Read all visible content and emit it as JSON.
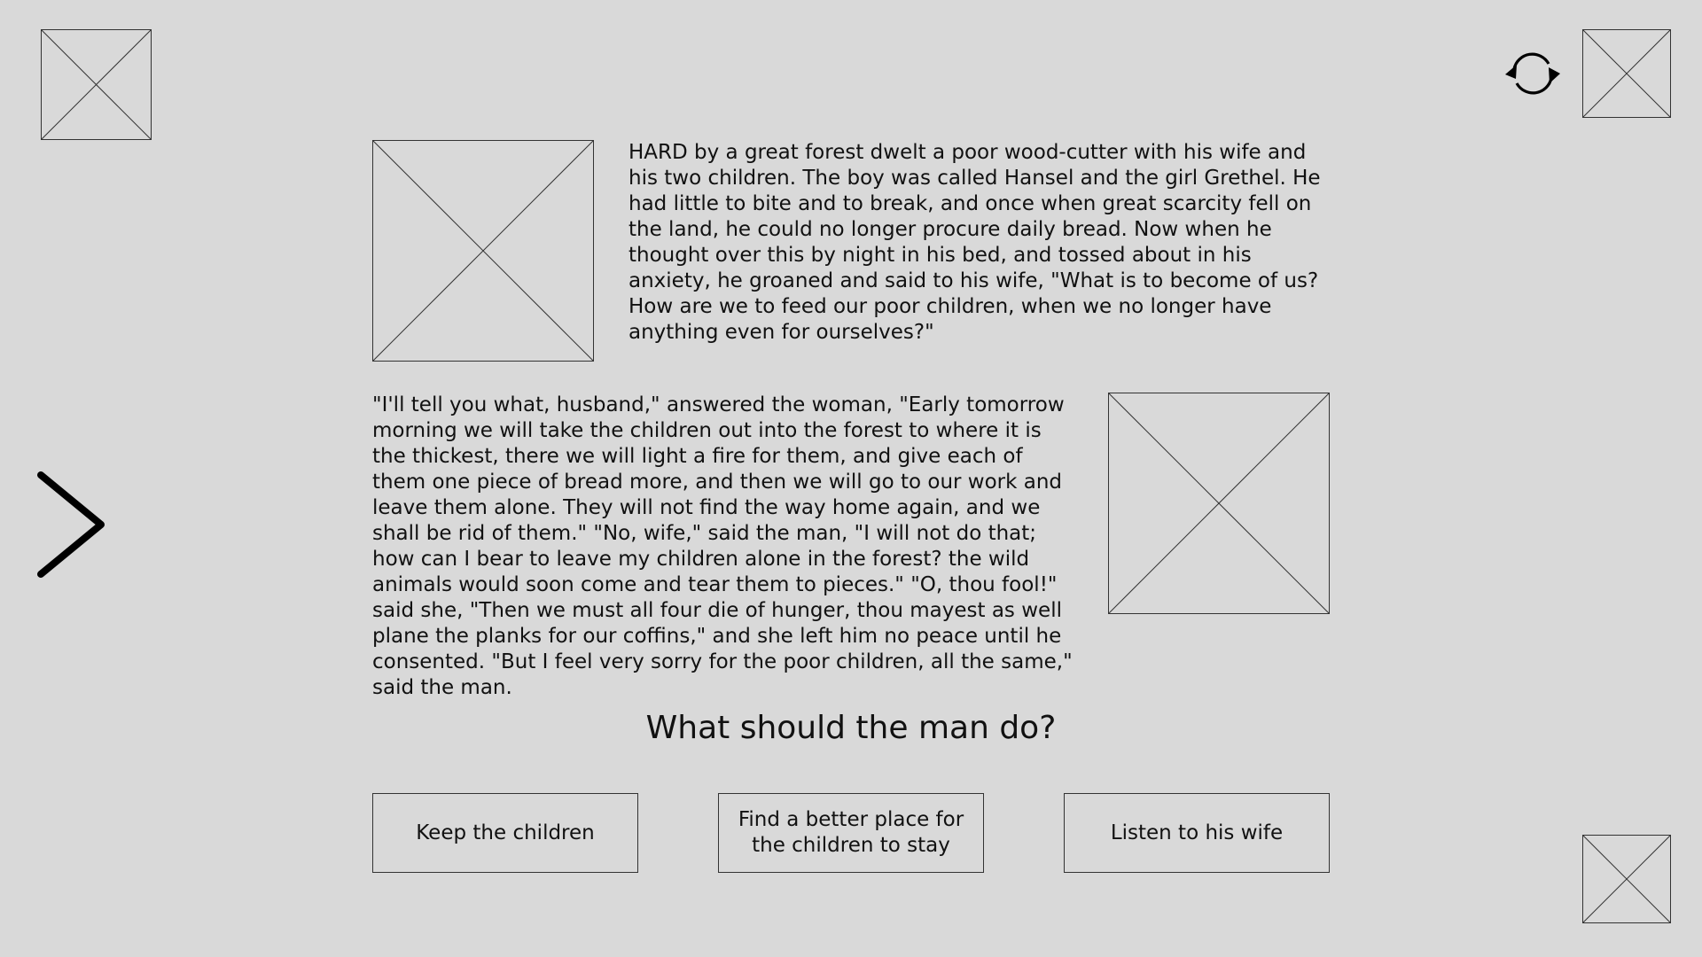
{
  "story": {
    "paragraph_1": "HARD by a great forest dwelt a poor wood-cutter with his wife and his two children. The boy was called Hansel and the girl Grethel. He had little to bite and to break, and once when great scarcity fell on the land, he could no longer procure daily bread. Now when he thought over this by night in his bed, and tossed about in his anxiety, he groaned and said to his wife, \"What is to become of us? How are we to feed our poor children, when we no longer have anything even for ourselves?\"",
    "paragraph_2": "\"I'll tell you what, husband,\" answered the woman, \"Early tomorrow morning we will take the children out into the forest to where it is the thickest, there we will light a fire for them, and give each of them one piece of bread more, and then we will go to our work and leave them alone. They will not find the way home again, and we shall be rid of them.\" \"No, wife,\" said the man, \"I will not do that; how can I bear to leave my children alone in the forest? the wild animals would soon come and tear them to pieces.\" \"O, thou fool!\" said she, \"Then we must all four die of hunger, thou mayest as well plane the planks for our coffins,\" and she left him no peace until he consented. \"But I feel very sorry for the poor children, all the same,\" said the man."
  },
  "question": "What should the man do?",
  "choices": [
    "Keep the children",
    "Find a better place for the children to stay",
    "Listen to his wife"
  ],
  "icons": {
    "next": "chevron-right-icon",
    "refresh": "refresh-icon"
  },
  "colors": {
    "background": "#d9d9d9",
    "stroke": "#333333",
    "text": "#111111"
  }
}
